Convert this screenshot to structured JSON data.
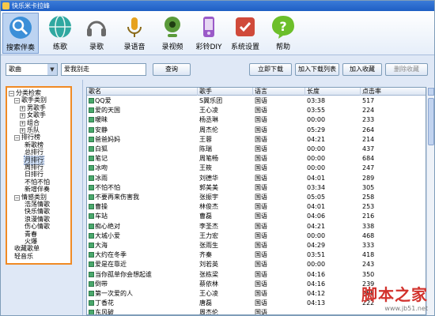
{
  "window": {
    "title": "快乐米卡拉峰"
  },
  "toolbar": {
    "items": [
      {
        "label": "搜索伴奏",
        "icon": "search-accompaniment-icon",
        "color": "#3b8fd8"
      },
      {
        "label": "练歌",
        "icon": "practice-globe-icon",
        "color": "#2fa8a0"
      },
      {
        "label": "录歌",
        "icon": "headphones-icon",
        "color": "#6a6a6a"
      },
      {
        "label": "录语音",
        "icon": "microphone-icon",
        "color": "#e6a21e"
      },
      {
        "label": "录视频",
        "icon": "webcam-icon",
        "color": "#5a9a3a"
      },
      {
        "label": "彩铃DIY",
        "icon": "ringtone-phone-icon",
        "color": "#9a5ac8"
      },
      {
        "label": "系统设置",
        "icon": "settings-icon",
        "color": "#d04a3a"
      },
      {
        "label": "帮助",
        "icon": "help-icon",
        "color": "#6cbf2a"
      }
    ]
  },
  "search": {
    "type_value": "歌曲",
    "query_value": "爱我别走",
    "query_button": "查询",
    "download_now": "立即下载",
    "add_download_list": "加入下载列表",
    "add_favorites": "加入收藏",
    "delete_favorites": "删除收藏"
  },
  "tree": {
    "items": [
      {
        "label": "分类检索",
        "level": 0,
        "expander": "−"
      },
      {
        "label": "歌手类别",
        "level": 1,
        "expander": "−"
      },
      {
        "label": "男歌手",
        "level": 2,
        "expander": "+"
      },
      {
        "label": "女歌手",
        "level": 2,
        "expander": "+"
      },
      {
        "label": "组合",
        "level": 2,
        "expander": "+"
      },
      {
        "label": "乐队",
        "level": 2,
        "expander": "+"
      },
      {
        "label": "排行榜",
        "level": 1,
        "expander": "−"
      },
      {
        "label": "新歌榜",
        "level": 3,
        "expander": ""
      },
      {
        "label": "总排行",
        "level": 3,
        "expander": ""
      },
      {
        "label": "月排行",
        "level": 3,
        "expander": "",
        "selected": true
      },
      {
        "label": "周排行",
        "level": 3,
        "expander": ""
      },
      {
        "label": "日排行",
        "level": 3,
        "expander": ""
      },
      {
        "label": "不怕不怕",
        "level": 3,
        "expander": ""
      },
      {
        "label": "新增伴奏",
        "level": 3,
        "expander": ""
      },
      {
        "label": "情感类别",
        "level": 1,
        "expander": "−"
      },
      {
        "label": "浩荡情歌",
        "level": 3,
        "expander": ""
      },
      {
        "label": "快乐情歌",
        "level": 3,
        "expander": ""
      },
      {
        "label": "浪漫情歌",
        "level": 3,
        "expander": ""
      },
      {
        "label": "伤心情歌",
        "level": 3,
        "expander": ""
      },
      {
        "label": "青春",
        "level": 3,
        "expander": ""
      },
      {
        "label": "火爆",
        "level": 3,
        "expander": ""
      },
      {
        "label": "收藏歌单",
        "level": 1,
        "expander": ""
      },
      {
        "label": "轻音乐",
        "level": 1,
        "expander": ""
      }
    ]
  },
  "table": {
    "headers": [
      "歌名",
      "歌手",
      "语言",
      "长度",
      "点击率"
    ],
    "rows": [
      [
        "QQ爱",
        "S翼乐团",
        "国语",
        "03:38",
        "517"
      ],
      [
        "爱的天国",
        "王心凌",
        "国语",
        "03:55",
        "224"
      ],
      [
        "暖昧",
        "杨丞琳",
        "国语",
        "00:00",
        "233"
      ],
      [
        "安静",
        "周杰伦",
        "国语",
        "05:29",
        "264"
      ],
      [
        "爸爸妈妈",
        "王蓉",
        "国语",
        "04:21",
        "214"
      ],
      [
        "白狐",
        "陈瑞",
        "国语",
        "00:00",
        "437"
      ],
      [
        "笔记",
        "周笔畅",
        "国语",
        "00:00",
        "684"
      ],
      [
        "冰吻",
        "王筱",
        "国语",
        "00:00",
        "247"
      ],
      [
        "冰雨",
        "刘德华",
        "国语",
        "04:01",
        "289"
      ],
      [
        "不怕不怕",
        "郭美美",
        "国语",
        "03:34",
        "305"
      ],
      [
        "不要再来伤害我",
        "张振宇",
        "国语",
        "05:05",
        "258"
      ],
      [
        "曹操",
        "林俊杰",
        "国语",
        "04:01",
        "253"
      ],
      [
        "车站",
        "曹磊",
        "国语",
        "04:06",
        "216"
      ],
      [
        "痴心绝对",
        "李圣杰",
        "国语",
        "04:21",
        "338"
      ],
      [
        "大城小爱",
        "王力宏",
        "国语",
        "00:00",
        "468"
      ],
      [
        "大海",
        "张雨生",
        "国语",
        "04:29",
        "333"
      ],
      [
        "大约在冬季",
        "齐秦",
        "国语",
        "03:51",
        "418"
      ],
      [
        "爱是在靠近",
        "刘若英",
        "国语",
        "00:00",
        "243"
      ],
      [
        "当你孤单你会想起谁",
        "张栋梁",
        "国语",
        "04:16",
        "350"
      ],
      [
        "倒带",
        "蔡依林",
        "国语",
        "04:16",
        "239"
      ],
      [
        "第一次爱的人",
        "王心凌",
        "国语",
        "04:12",
        "255"
      ],
      [
        "丁香花",
        "唐磊",
        "国语",
        "04:13",
        "222"
      ],
      [
        "东风破",
        "周杰伦",
        "国语",
        "",
        ""
      ]
    ]
  },
  "watermark": {
    "title": "脚本之家",
    "url": "www.jb51.net"
  }
}
